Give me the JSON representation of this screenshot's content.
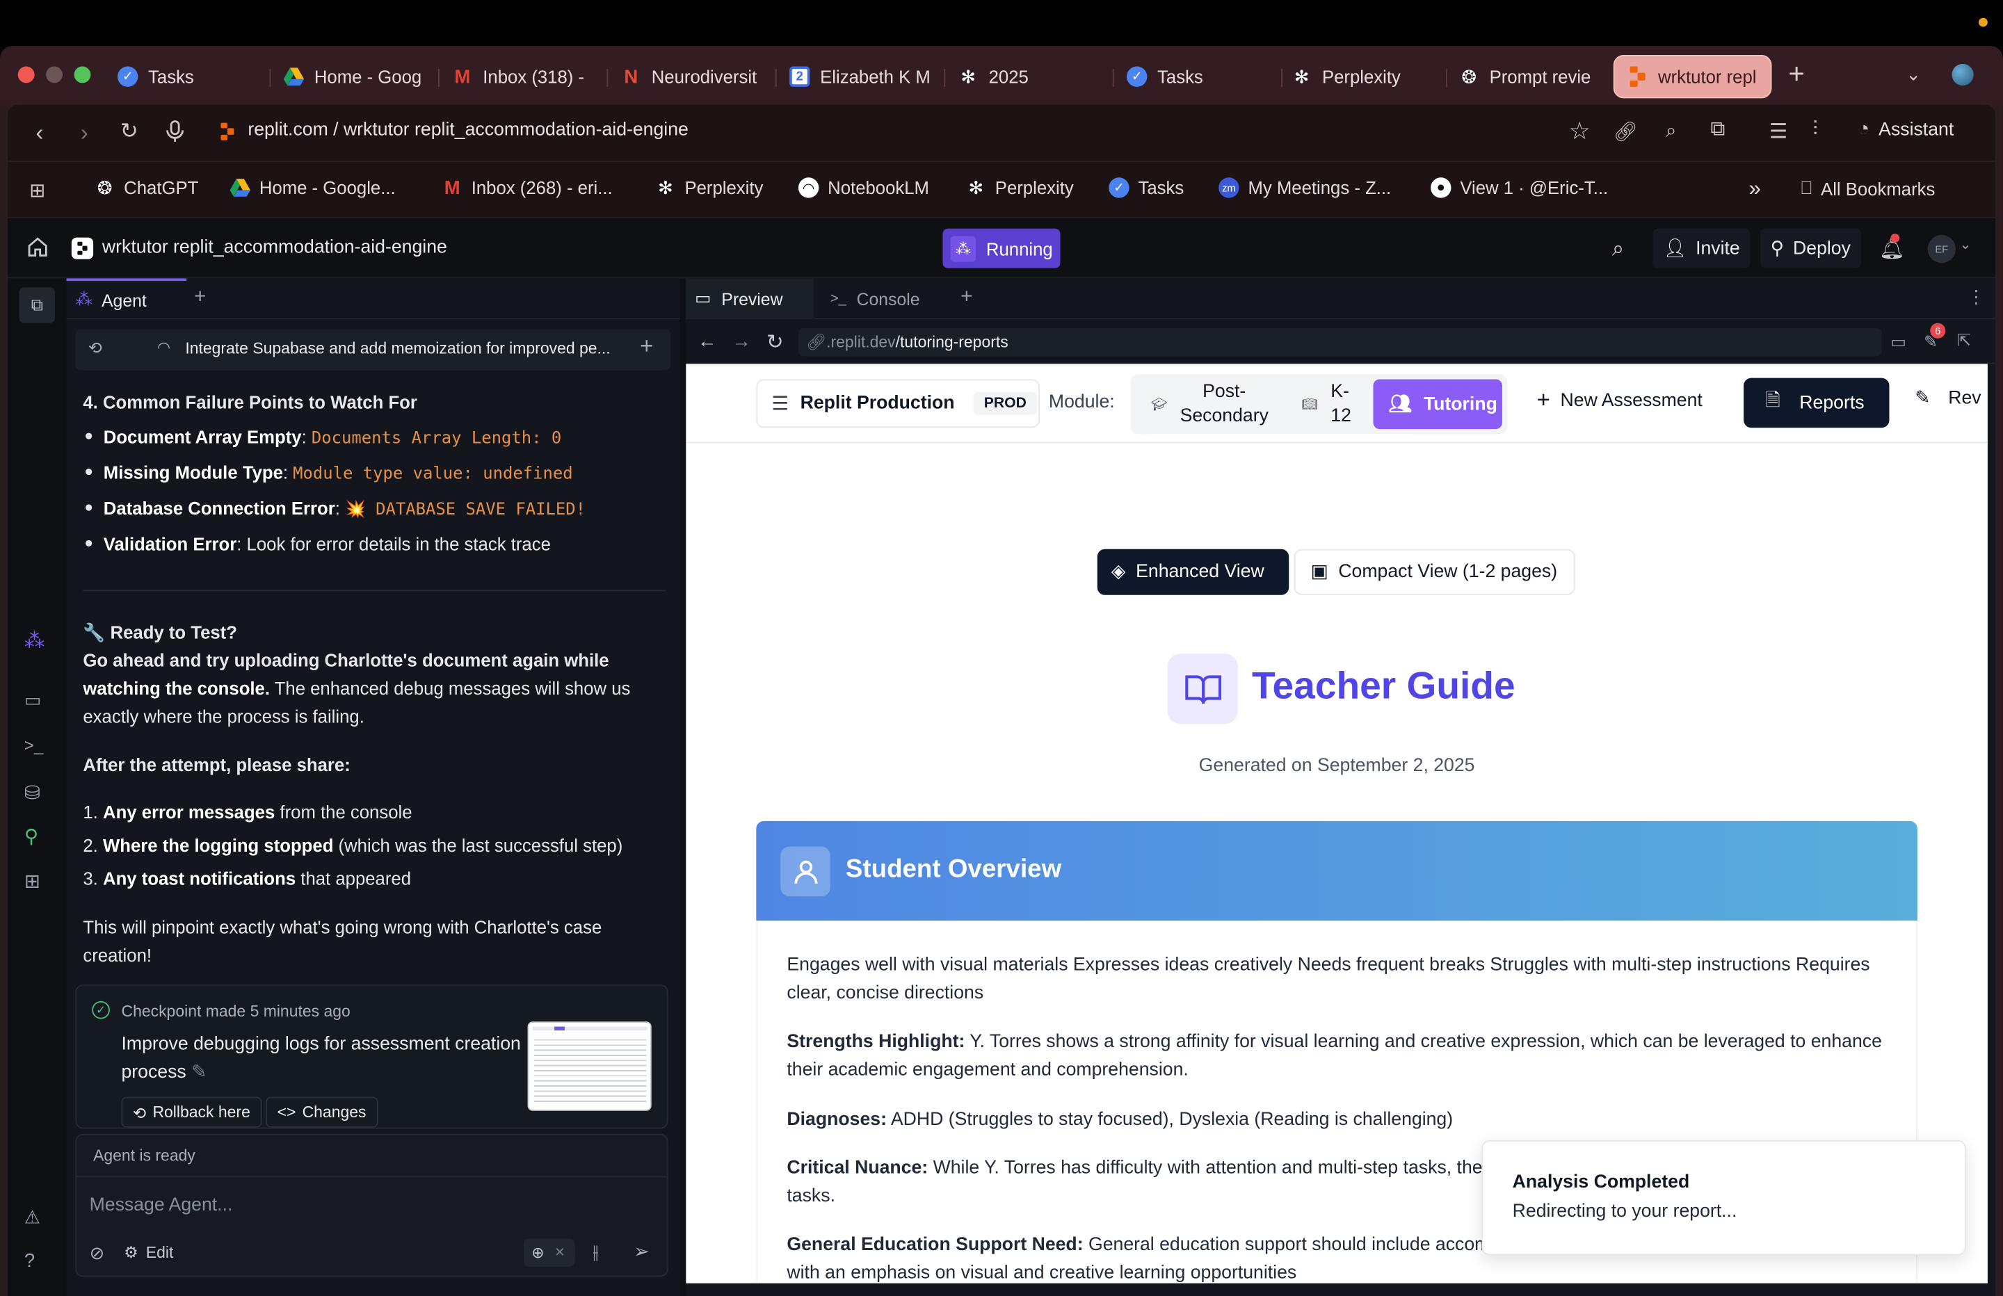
{
  "browser": {
    "tabs": [
      {
        "label": "Tasks",
        "icon": "google-tasks-icon"
      },
      {
        "label": "Home - Goog",
        "icon": "google-drive-icon"
      },
      {
        "label": "Inbox (318) -",
        "icon": "gmail-icon"
      },
      {
        "label": "Neurodiversit",
        "icon": "notion-icon"
      },
      {
        "label": "Elizabeth K M",
        "icon": "calendar-icon"
      },
      {
        "label": "2025",
        "icon": "perplexity-icon"
      },
      {
        "label": "Tasks",
        "icon": "google-tasks-icon"
      },
      {
        "label": "Perplexity",
        "icon": "perplexity-icon"
      },
      {
        "label": "Prompt revie",
        "icon": "chatgpt-icon"
      },
      {
        "label": "wrktutor repl",
        "icon": "replit-icon"
      }
    ],
    "address": "replit.com / wrktutor replit_accommodation-aid-engine",
    "assistant_label": "Assistant",
    "bookmarks": [
      {
        "label": "ChatGPT"
      },
      {
        "label": "Home - Google..."
      },
      {
        "label": "Inbox (268) - eri..."
      },
      {
        "label": "Perplexity"
      },
      {
        "label": "NotebookLM"
      },
      {
        "label": "Perplexity"
      },
      {
        "label": "Tasks"
      },
      {
        "label": "My Meetings - Z..."
      },
      {
        "label": "View 1 · @Eric-T..."
      }
    ],
    "more_bookmarks": "»",
    "all_bookmarks": "All Bookmarks"
  },
  "replit": {
    "project_name": "wrktutor replit_accommodation-aid-engine",
    "status": "Running",
    "invite": "Invite",
    "deploy": "Deploy",
    "avatar_initials": "EF",
    "agent_tab": "Agent",
    "thread_title": "Integrate Supabase and add memoization for improved pe...",
    "section_title": "4. Common Failure Points to Watch For",
    "failure_points": [
      {
        "label": "Document Array Empty",
        "code": "Documents Array Length: 0"
      },
      {
        "label": "Missing Module Type",
        "code": "Module type value: undefined"
      },
      {
        "label": "Database Connection Error",
        "code": "💥 DATABASE SAVE FAILED!"
      },
      {
        "label": "Validation Error",
        "text": ": Look for error details in the stack trace"
      }
    ],
    "ready_title": "🔧 Ready to Test?",
    "ready_line1_bold": "Go ahead and try uploading Charlotte's document again while",
    "ready_line2_bold": "watching the console.",
    "ready_line2_rest": " The enhanced debug messages will show us",
    "ready_line3": "exactly where the process is failing.",
    "after_title": "After the attempt, please share:",
    "share_items": [
      {
        "num": "1.",
        "bold": "Any error messages",
        "rest": " from the console"
      },
      {
        "num": "2.",
        "bold": "Where the logging stopped",
        "rest": " (which was the last successful step)"
      },
      {
        "num": "3.",
        "bold": "Any toast notifications",
        "rest": " that appeared"
      }
    ],
    "closing_line1": "This will pinpoint exactly what's going wrong with Charlotte's case",
    "closing_line2": "creation!",
    "checkpoint_label": "Checkpoint made",
    "checkpoint_time": "5 minutes ago",
    "checkpoint_title_1": "Improve debugging logs for assessment creation",
    "checkpoint_title_2": "process",
    "rollback": "Rollback here",
    "changes": "Changes",
    "agent_status": "Agent is ready",
    "message_placeholder": "Message Agent...",
    "edit_label": "Edit",
    "preview_tab": "Preview",
    "console_tab": "Console",
    "preview_url_domain": ".replit.dev",
    "preview_url_path": "/tutoring-reports",
    "notif_count": "6"
  },
  "webapp": {
    "env_label": "Replit Production",
    "env_badge": "PROD",
    "module_label": "Module:",
    "modules": [
      "Post-\nSecondary",
      "K-\n12",
      "Tutoring"
    ],
    "module_post_1": "Post-",
    "module_post_2": "Secondary",
    "module_k_1": "K-",
    "module_k_2": "12",
    "module_tutoring": "Tutoring",
    "new_assessment": "New Assessment",
    "reports": "Reports",
    "review_truncated": "Rev",
    "enhanced_view": "Enhanced View",
    "compact_view": "Compact View (1-2 pages)",
    "guide_title": "Teacher Guide",
    "generated_on": "Generated on September 2, 2025",
    "overview_title": "Student Overview",
    "overview_summary_1": "Engages well with visual materials Expresses ideas creatively Needs frequent breaks Struggles with multi-step instructions Requires",
    "overview_summary_2": "clear, concise directions",
    "strengths_label": "Strengths Highlight:",
    "strengths_1": " Y. Torres shows a strong affinity for visual learning and creative expression, which can be leveraged to enhance",
    "strengths_2": "their academic engagement and comprehension.",
    "diagnoses_label": "Diagnoses:",
    "diagnoses": " ADHD (Struggles to stay focused), Dyslexia (Reading is challenging)",
    "nuance_label": "Critical Nuance:",
    "nuance_1": " While Y. Torres has difficulty with attention and multi-step tasks, they",
    "nuance_2": "tasks.",
    "gened_label": "General Education Support Need:",
    "gened_1": " General education support should include accomm",
    "gened_2": "with an emphasis on visual and creative learning opportunities",
    "toast_title": "Analysis Completed",
    "toast_body": "Redirecting to your report..."
  }
}
